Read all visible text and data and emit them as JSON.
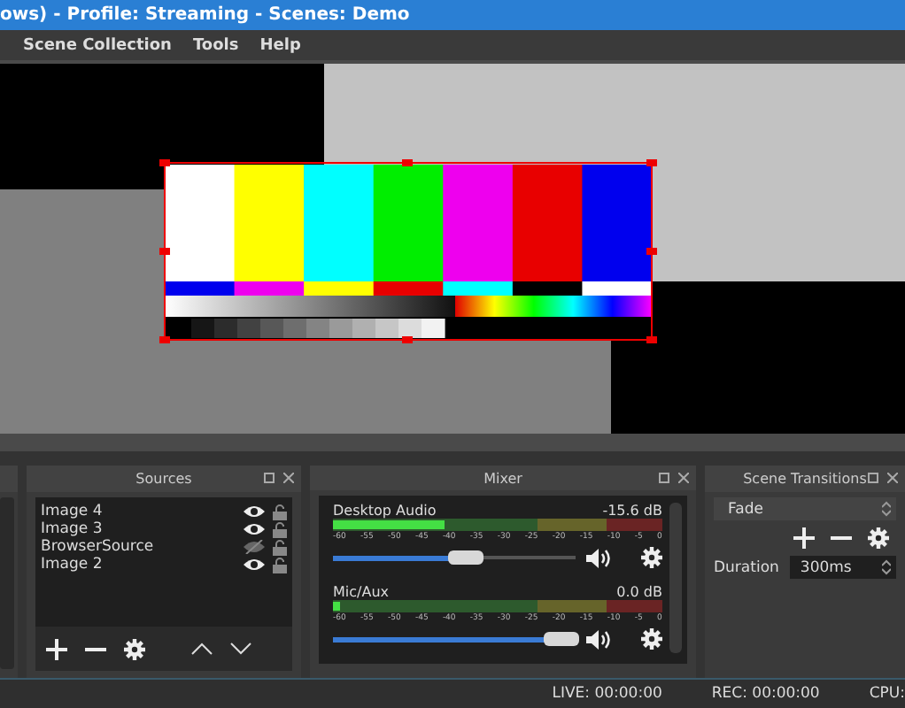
{
  "window": {
    "title": "ows) - Profile: Streaming - Scenes: Demo"
  },
  "menu": [
    "Scene Collection",
    "Tools",
    "Help"
  ],
  "sources": {
    "title": "Sources",
    "items": [
      {
        "name": "Image 4",
        "visible": true,
        "locked": false
      },
      {
        "name": "Image 3",
        "visible": true,
        "locked": false
      },
      {
        "name": "BrowserSource",
        "visible": false,
        "locked": false
      },
      {
        "name": "Image 2",
        "visible": true,
        "locked": false
      }
    ]
  },
  "mixer": {
    "title": "Mixer",
    "channels": [
      {
        "name": "Desktop Audio",
        "reading": "-15.6 dB",
        "meter": {
          "level": 0.34
        },
        "volume": {
          "level": 0.55
        },
        "scale": [
          "-60",
          "-55",
          "-50",
          "-45",
          "-40",
          "-35",
          "-30",
          "-25",
          "-20",
          "-15",
          "-10",
          "-5",
          "0"
        ]
      },
      {
        "name": "Mic/Aux",
        "reading": "0.0 dB",
        "meter": {
          "level": 0.02
        },
        "volume": {
          "level": 0.94
        },
        "scale": [
          "-60",
          "-55",
          "-50",
          "-45",
          "-40",
          "-35",
          "-30",
          "-25",
          "-20",
          "-15",
          "-10",
          "-5",
          "0"
        ]
      }
    ]
  },
  "transitions": {
    "title": "Scene Transitions",
    "transition": "Fade",
    "duration_label": "Duration",
    "duration": "300ms"
  },
  "status_bar": {
    "live": "LIVE: 00:00:00",
    "rec": "REC: 00:00:00",
    "cpu": "CPU:"
  }
}
